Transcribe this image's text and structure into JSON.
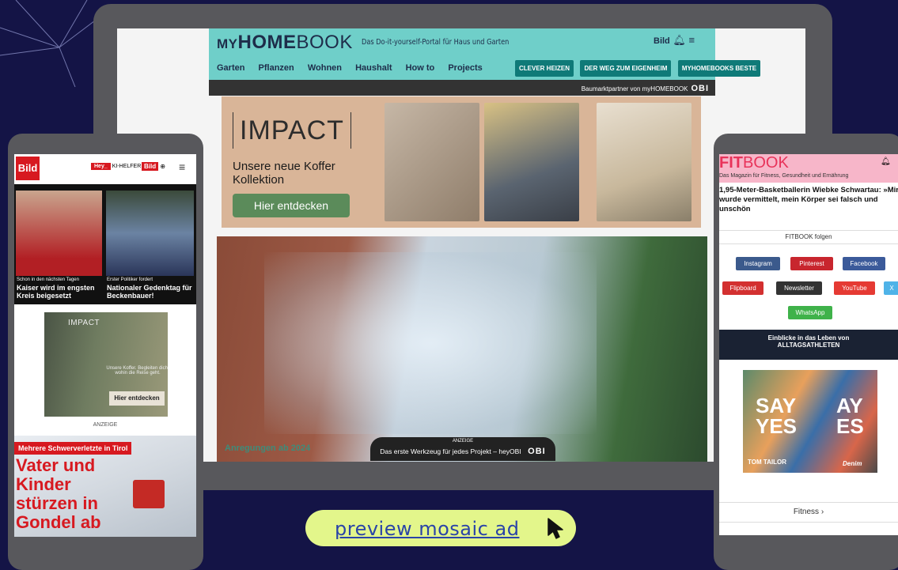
{
  "colors": {
    "background": "#141446",
    "device_frame": "#58585c",
    "myhomebook_header": "#6fcfc9",
    "myhomebook_button": "#0f7a78",
    "bild_red": "#d71920",
    "fitbook_pink": "#f7b6c9",
    "preview_button": "#e3f68b",
    "preview_text": "#2a44a8"
  },
  "myhomebook": {
    "logo_my": "MY",
    "logo_home": "HOME",
    "logo_book": "BOOK",
    "tagline": "Das Do-it-yourself-Portal für Haus und Garten",
    "bild_badge": "Bild",
    "icons": [
      "bell-icon",
      "menu-icon"
    ],
    "nav": [
      "Garten",
      "Pflanzen",
      "Wohnen",
      "Haushalt",
      "How to",
      "Projects"
    ],
    "buttons": [
      "CLEVER HEIZEN",
      "DER WEG ZUM EIGENHEIM",
      "MYHOMEBOOKS BESTE"
    ],
    "partner_text": "Baumarktpartner von myHOMEBOOK",
    "partner_logo": "OBI",
    "ad": {
      "logo": "IMPACT",
      "title": "Unsere neue Koffer Kollektion",
      "cta": "Hier entdecken"
    },
    "hero": {
      "label": "Anregungen ab 2024",
      "ad_badge": "ANZEIGE",
      "ad_text": "Das erste Werkzeug für jedes Projekt – heyOBI",
      "ad_logo": "OBI"
    }
  },
  "bild": {
    "logo": "Bild",
    "hey_badge": "Hey_",
    "hey_label": "KI-HELFER",
    "plus_badge": "Bild",
    "news": [
      {
        "kicker": "Schon in den nächsten Tagen",
        "headline": "Kaiser wird im engsten Kreis beigesetzt"
      },
      {
        "kicker": "Erster Politiker fordert",
        "headline": "Nationaler Gedenktag für Beckenbauer!"
      }
    ],
    "ad": {
      "logo": "IMPACT",
      "text": "Unsere Koffer. Begleiten dich, wohin die Reise geht.",
      "cta": "Hier entdecken"
    },
    "ad_label": "ANZEIGE",
    "story": {
      "kicker": "Mehrere Schwerverletzte in Tirol",
      "headline": "Vater und Kinder stürzen in Gondel ab"
    }
  },
  "fitbook": {
    "logo_fit": "FIT",
    "logo_book": "BOOK",
    "subtitle": "Das Magazin für Fitness, Gesundheit und Ernährung",
    "headline": "1,95-Meter-Basketballerin Wiebke Schwartau: »Mir wurde vermittelt, mein Körper sei falsch und unschön",
    "follow_label": "FITBOOK folgen",
    "social": [
      {
        "label": "Instagram",
        "color": "#3b5a8c"
      },
      {
        "label": "Pinterest",
        "color": "#c8262e"
      },
      {
        "label": "Facebook",
        "color": "#3b5a9a"
      },
      {
        "label": "Flipboard",
        "color": "#d33030"
      },
      {
        "label": "Newsletter",
        "color": "#333333"
      },
      {
        "label": "YouTube",
        "color": "#e53a33"
      },
      {
        "label": "X",
        "color": "#4fb3e8"
      },
      {
        "label": "WhatsApp",
        "color": "#3fb24a"
      }
    ],
    "banner_title": "Einblicke in das Leben von ALLTAGSATHLETEN",
    "ad": {
      "text_left": "SAY YES",
      "text_right": "AY ES",
      "brand": "TOM TAILOR",
      "brand2": "Denim"
    },
    "section_link": "Fitness ›"
  },
  "preview_button": {
    "label": "preview mosaic ad",
    "icon": "cursor-icon"
  }
}
